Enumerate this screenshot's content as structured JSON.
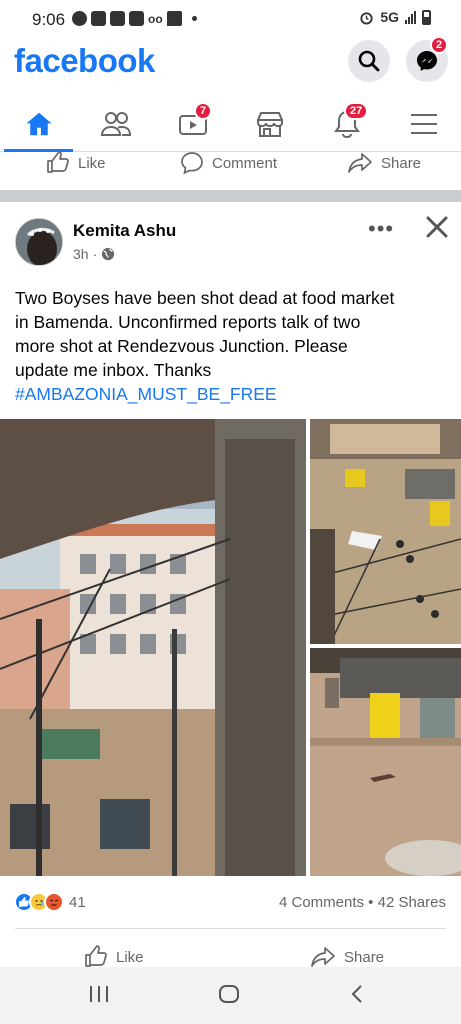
{
  "status_bar": {
    "time": "9:06",
    "network": "5G",
    "notification_icons": [
      "whatsapp-icon",
      "youtube-icon",
      "youtube-icon",
      "youtube-icon",
      "voicemail-icon",
      "message-icon",
      "dot-icon"
    ],
    "system_icons": [
      "alarm-icon",
      "signal-icon",
      "battery-icon"
    ]
  },
  "header": {
    "logo": "facebook",
    "messenger_badge": "2",
    "brand_color": "#1877f2"
  },
  "nav": {
    "tabs": [
      {
        "name": "home",
        "active": true
      },
      {
        "name": "friends"
      },
      {
        "name": "watch",
        "badge": "7"
      },
      {
        "name": "marketplace"
      },
      {
        "name": "notifications",
        "badge": "27"
      },
      {
        "name": "menu"
      }
    ]
  },
  "prev_post_actions": {
    "like": "Like",
    "comment": "Comment",
    "share": "Share"
  },
  "post": {
    "author": "Kemita Ashu",
    "time": "3h",
    "more": "•••",
    "text_lines": [
      "Two Boyses have been shot dead at food market",
      "in Bamenda.  Unconfirmed reports talk of two",
      "more shot at Rendezvous Junction.  Please",
      "update me inbox.  Thanks"
    ],
    "hashtag": "#AMBAZONIA_MUST_BE_FREE",
    "reaction_count": "41",
    "comments": "4 Comments",
    "shares": "42 Shares",
    "comments_shares_sep": " • ",
    "like_label": "Like",
    "share_label": "Share"
  }
}
